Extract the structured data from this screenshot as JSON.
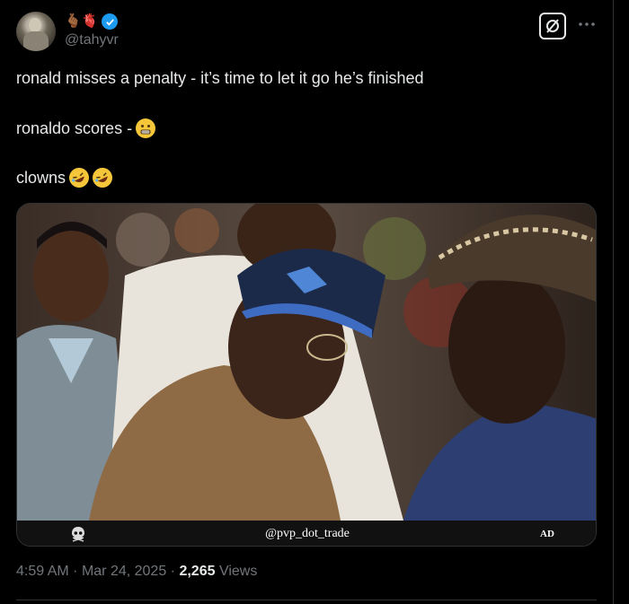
{
  "author": {
    "handle": "@tahyvr",
    "name_emojis": "🫰🏾🫀"
  },
  "tweet": {
    "line1": "ronald misses a penalty - it’s time to let it go he’s finished",
    "line2": "ronaldo scores -",
    "line3": "clowns"
  },
  "media": {
    "watermark_text": "@pvp_dot_trade",
    "ad_label": "AD"
  },
  "meta": {
    "time": "4:59 AM",
    "separator": "·",
    "date": "Mar 24, 2025",
    "views_count": "2,265",
    "views_label": "Views"
  },
  "icons": {
    "verified": "verified-badge-icon",
    "grok": "grok-icon",
    "more": "more-icon"
  },
  "colors": {
    "background": "#000000",
    "text": "#e7e9ea",
    "secondary": "#71767b",
    "verified": "#1d9bf0",
    "border": "#2f3336"
  }
}
